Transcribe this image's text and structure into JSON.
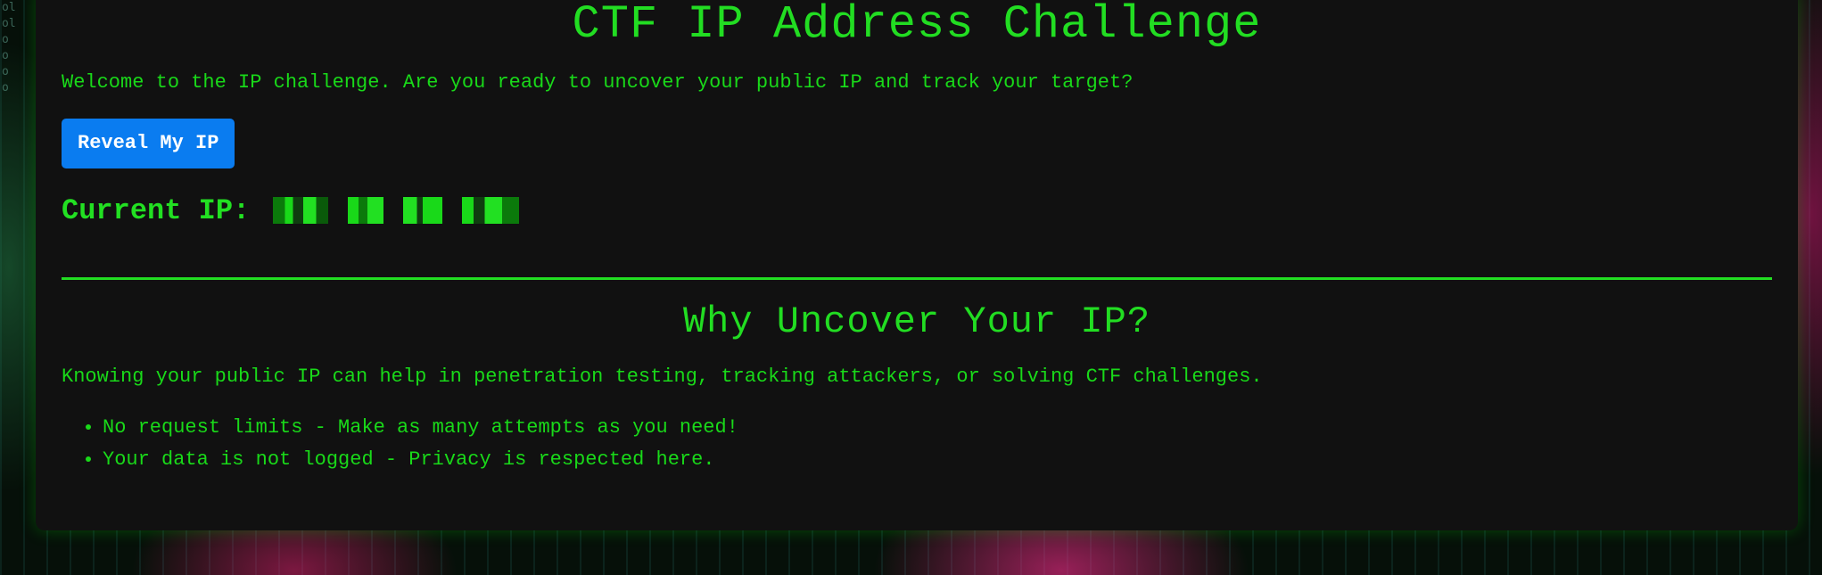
{
  "page": {
    "title": "CTF IP Address Challenge",
    "intro": "Welcome to the IP challenge. Are you ready to uncover your public IP and track your target?",
    "reveal_button_label": "Reveal My IP",
    "current_ip_label": "Current IP:",
    "current_ip_value_state": "pixelated / redacted"
  },
  "why_section": {
    "heading": "Why Uncover Your IP?",
    "paragraph": "Knowing your public IP can help in penetration testing, tracking attackers, or solving CTF challenges.",
    "bullets": [
      "No request limits - Make as many attempts as you need!",
      "Your data is not logged - Privacy is respected here."
    ]
  },
  "colors": {
    "accent_green": "#22dd22",
    "card_background": "#111111",
    "button_blue": "#0a7cf0"
  }
}
